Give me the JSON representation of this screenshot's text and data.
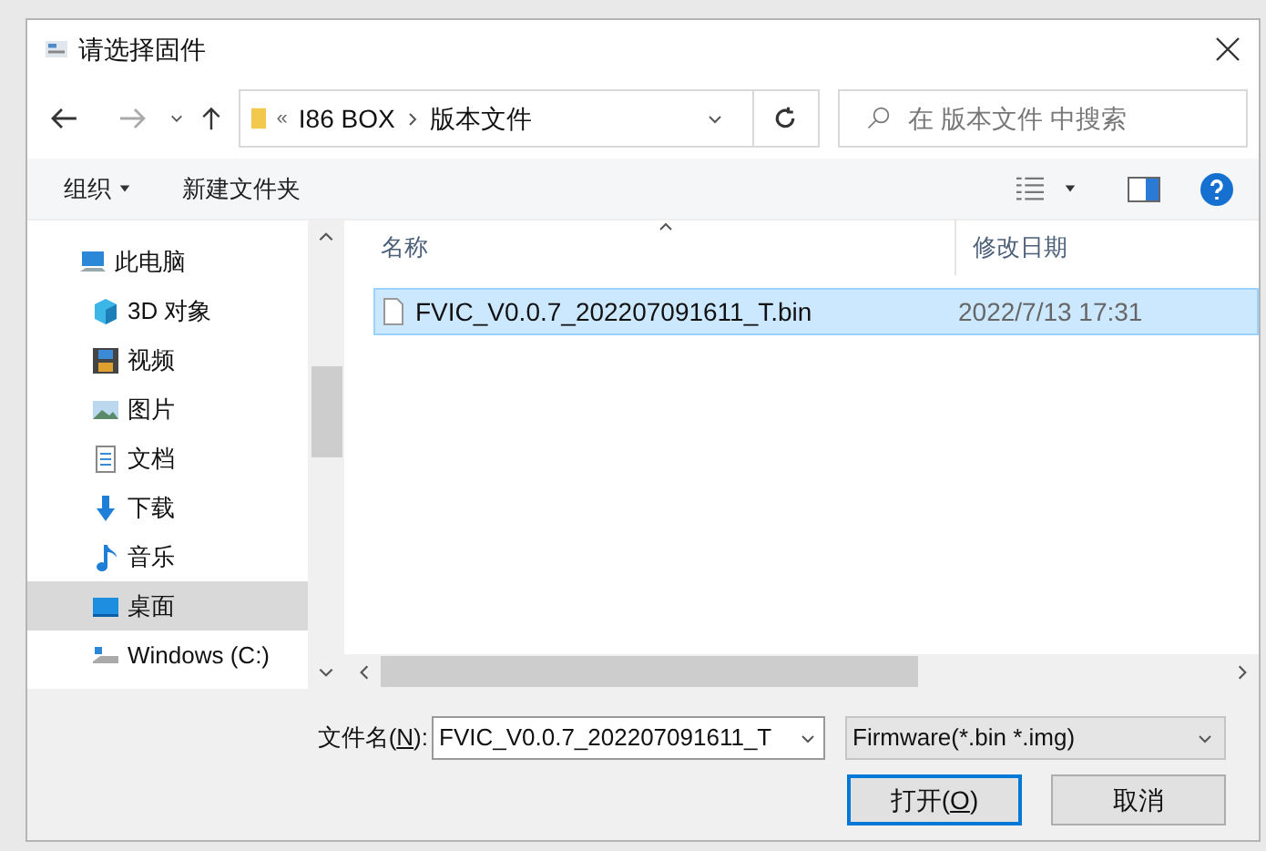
{
  "window": {
    "title": "请选择固件"
  },
  "address_bar": {
    "overflow": "«",
    "path": [
      "I86 BOX",
      "版本文件"
    ]
  },
  "search": {
    "placeholder": "在 版本文件 中搜索"
  },
  "toolbar": {
    "organize": "组织",
    "new_folder": "新建文件夹"
  },
  "sidebar": {
    "items": [
      {
        "label": "此电脑",
        "kind": "pc",
        "selected": false,
        "children": [
          {
            "label": "3D 对象",
            "kind": "cube",
            "selected": false
          },
          {
            "label": "视频",
            "kind": "video",
            "selected": false
          },
          {
            "label": "图片",
            "kind": "picture",
            "selected": false
          },
          {
            "label": "文档",
            "kind": "document",
            "selected": false
          },
          {
            "label": "下载",
            "kind": "download",
            "selected": false
          },
          {
            "label": "音乐",
            "kind": "music",
            "selected": false
          },
          {
            "label": "桌面",
            "kind": "desktop",
            "selected": true
          },
          {
            "label": "Windows (C:)",
            "kind": "drive",
            "selected": false
          }
        ]
      }
    ]
  },
  "file_list": {
    "columns": [
      "名称",
      "修改日期"
    ],
    "rows": [
      {
        "name": "FVIC_V0.0.7_202207091611_T.bin",
        "modified": "2022/7/13 17:31",
        "selected": true
      }
    ]
  },
  "filename": {
    "label_parts": [
      "文件名(",
      "N",
      "):"
    ],
    "value": "FVIC_V0.0.7_202207091611_T"
  },
  "filter": {
    "value": "Firmware(*.bin *.img)"
  },
  "buttons": [
    {
      "label_parts": [
        "打开(",
        "O",
        ")"
      ],
      "kind": "default"
    },
    {
      "label_parts": [
        "取消"
      ],
      "kind": "normal"
    }
  ]
}
